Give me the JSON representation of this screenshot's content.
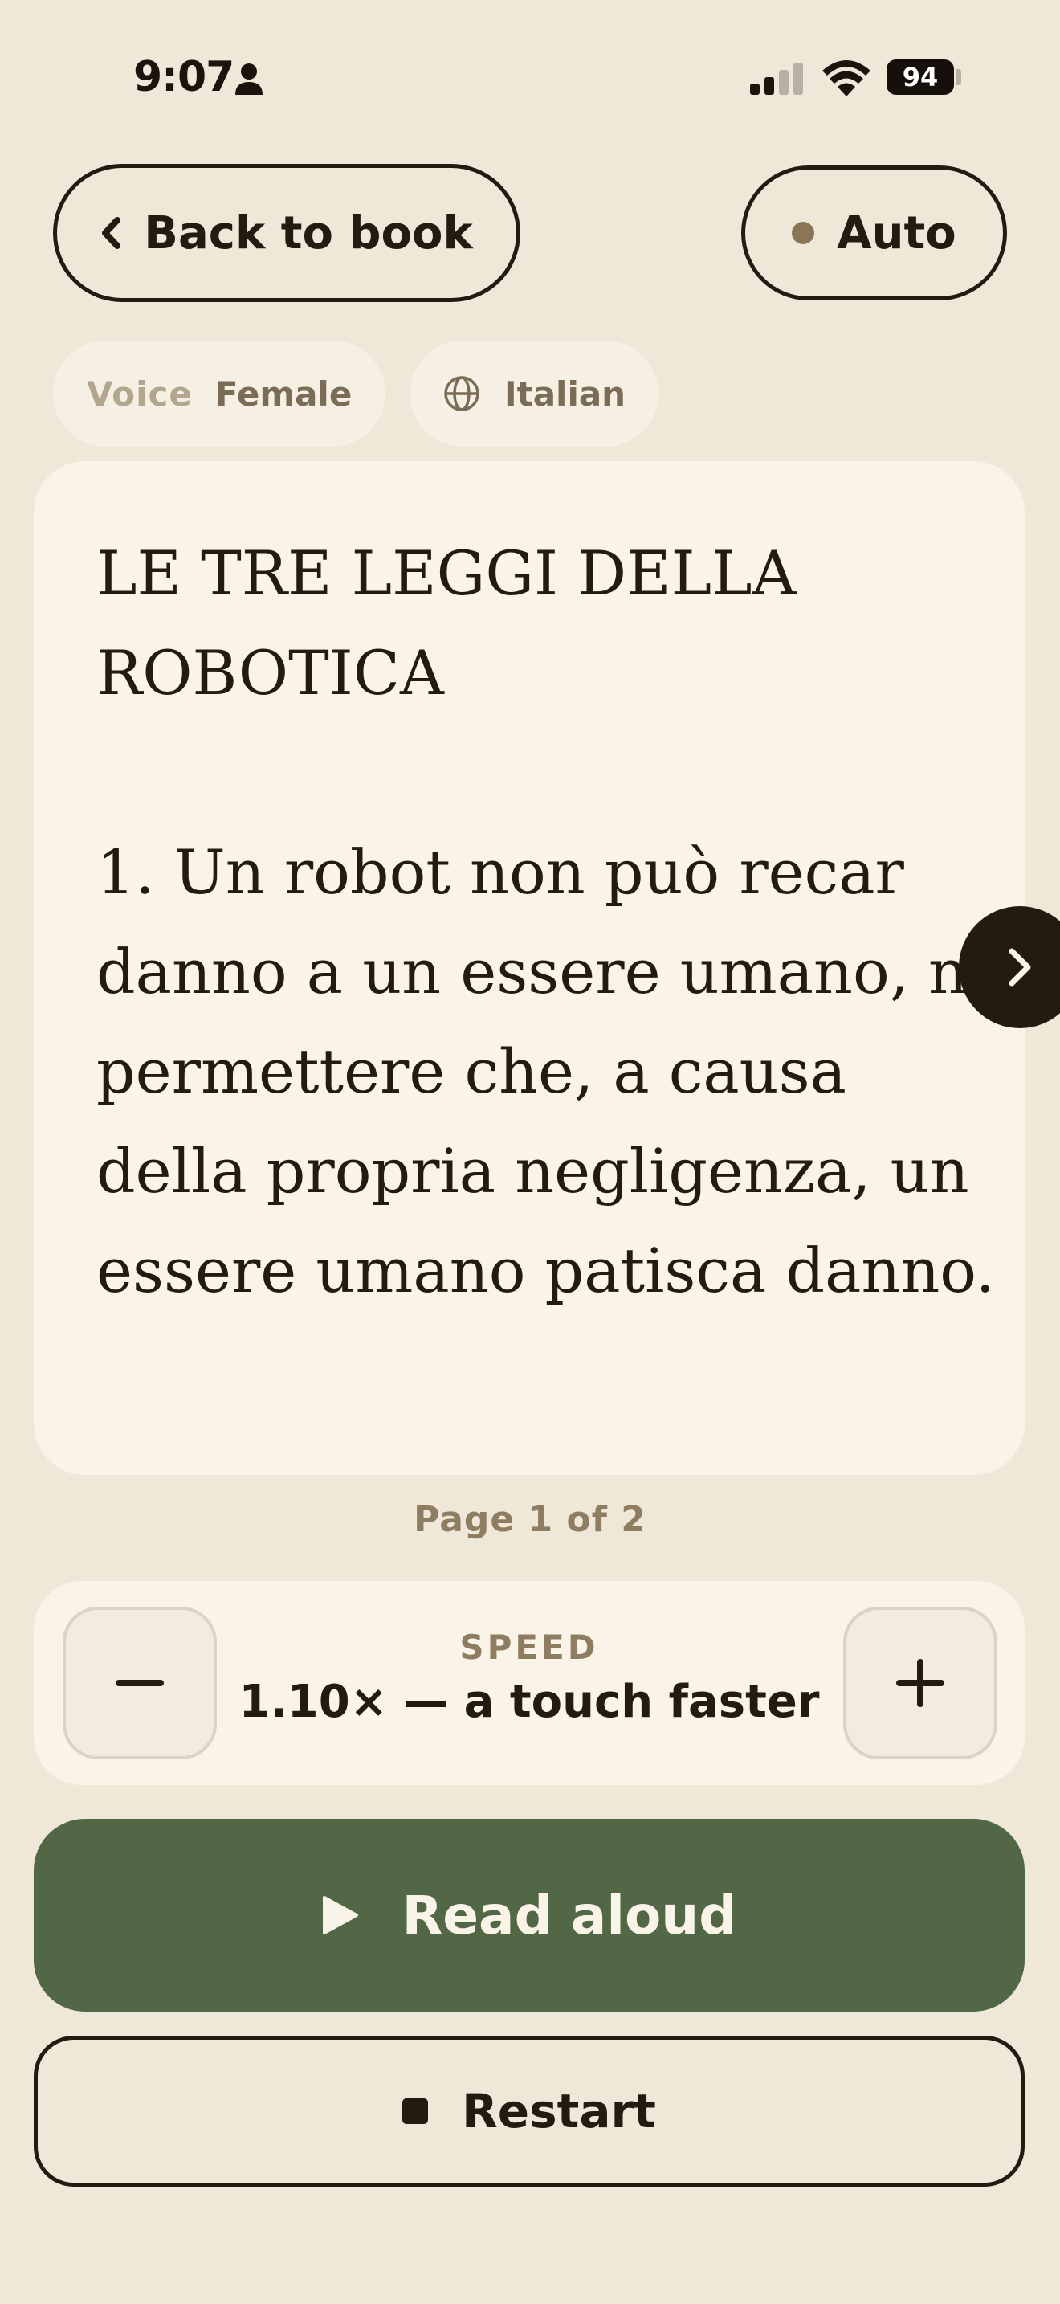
{
  "status_bar": {
    "time": "9:07",
    "battery": "94"
  },
  "header": {
    "back_label": "Back to book",
    "auto_label": "Auto"
  },
  "chips": {
    "voice_key": "Voice",
    "voice_value": "Female",
    "language": "Italian"
  },
  "reading": {
    "title": "LE TRE LEGGI DELLA ROBOTICA",
    "body": "1. Un robot non può recar danno a un essere umano, né permettere che, a causa della propria negligenza, un essere umano patisca danno."
  },
  "pagination": {
    "label": "Page 1 of 2",
    "current": 1,
    "total": 2
  },
  "speed": {
    "label": "SPEED",
    "value": "1.10× — a touch faster"
  },
  "actions": {
    "read_aloud": "Read aloud",
    "restart": "Restart"
  },
  "icons": [
    "person-icon",
    "signal-icon",
    "wifi-icon",
    "chevron-left-icon",
    "globe-icon",
    "chevron-right-icon",
    "minus-icon",
    "plus-icon",
    "play-icon",
    "stop-icon"
  ],
  "colors": {
    "background": "#EFE7D8",
    "card": "#FAF3E7",
    "ink": "#231A10",
    "primary": "#516745",
    "muted": "#8E7D60"
  }
}
